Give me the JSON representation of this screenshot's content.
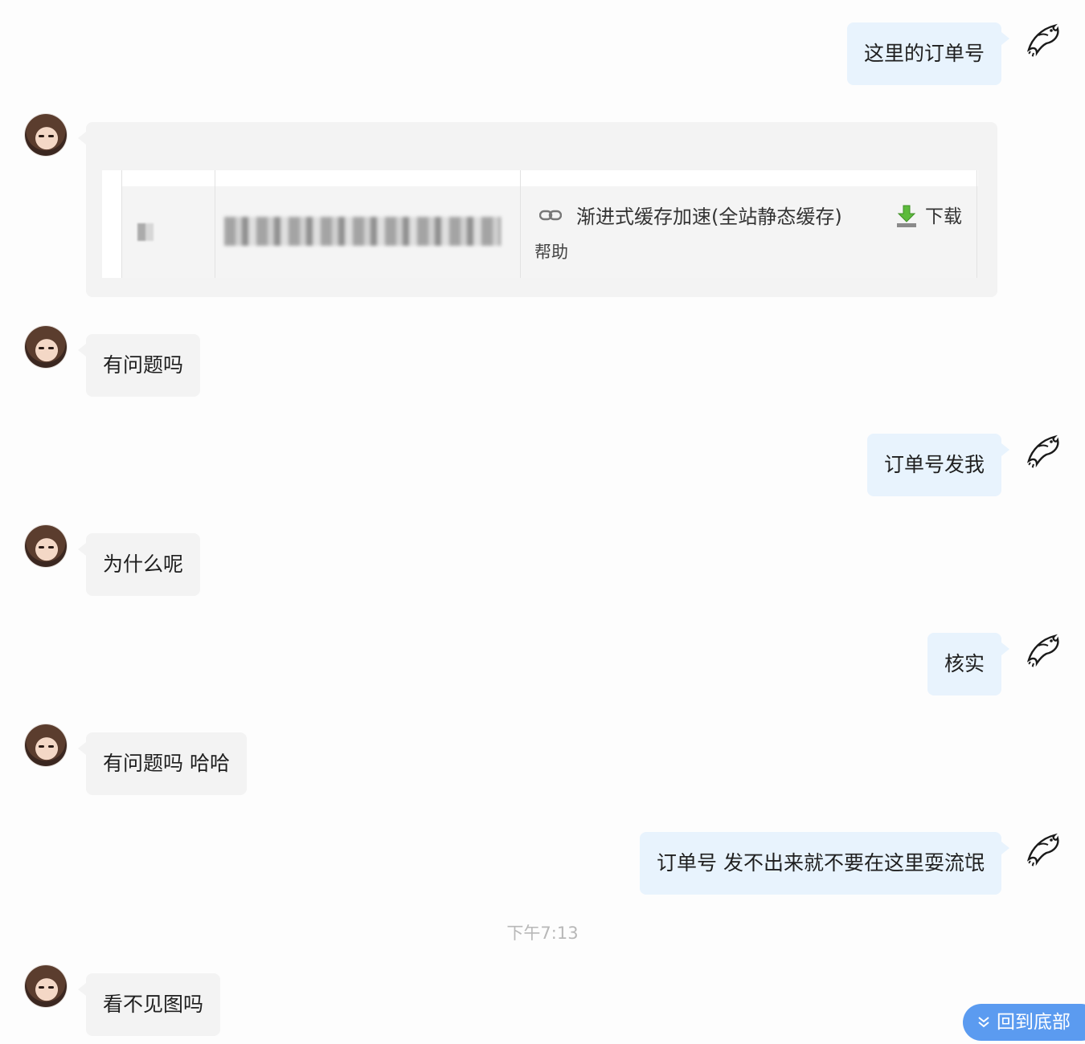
{
  "messages": {
    "m1": "这里的订单号",
    "m3": "有问题吗",
    "m4": "订单号发我",
    "m5": "为什么呢",
    "m6": "核实",
    "m7": "有问题吗 哈哈",
    "m8": "订单号 发不出来就不要在这里耍流氓",
    "m9": "看不见图吗"
  },
  "screenshot": {
    "product": "渐进式缓存加速(全站静态缓存)",
    "download_label": "下载",
    "help_label": "帮助"
  },
  "timestamp": "下午7:13",
  "back_to_bottom": "回到底部",
  "icons": {
    "self_avatar": "fish-icon",
    "other_avatar": "user-photo",
    "link": "link-icon",
    "download": "download-icon",
    "chevron": "chevron-down-icon"
  },
  "colors": {
    "self_bubble": "#e8f3fd",
    "other_bubble": "#f3f3f3",
    "accent": "#5b9bf0"
  }
}
